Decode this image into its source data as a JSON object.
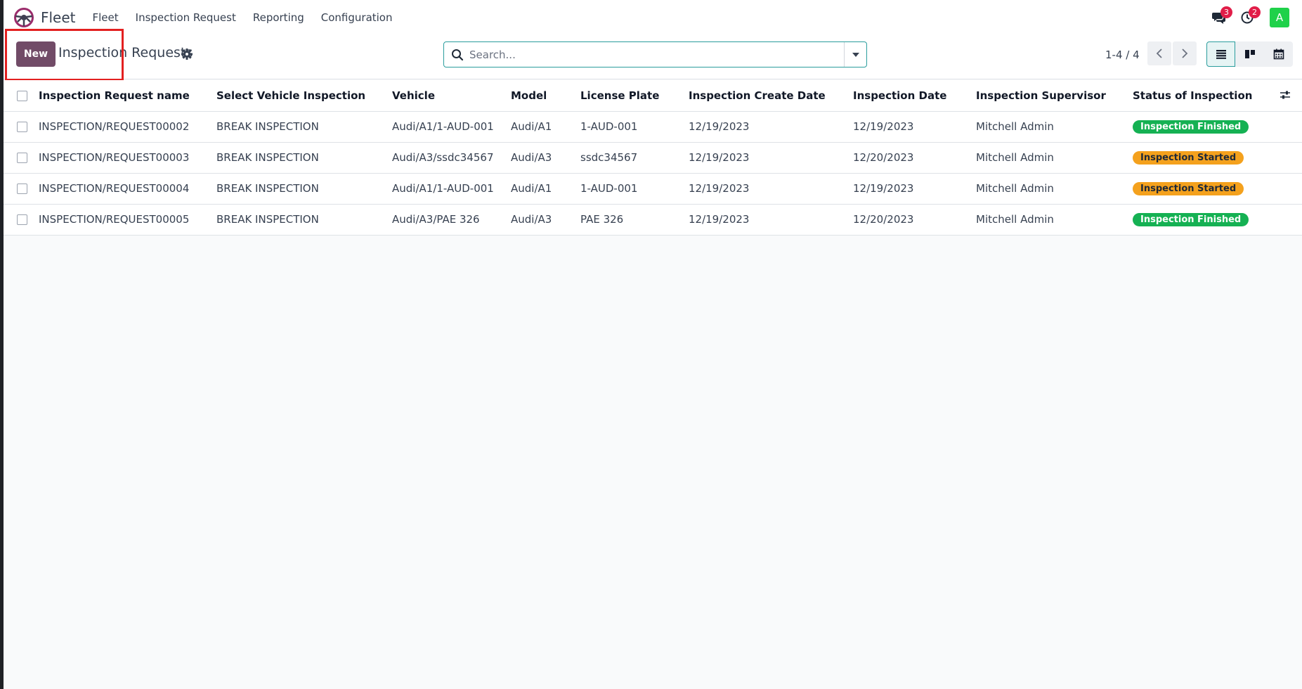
{
  "navbar": {
    "app_name": "Fleet",
    "menu": [
      {
        "label": "Fleet"
      },
      {
        "label": "Inspection Request"
      },
      {
        "label": "Reporting"
      },
      {
        "label": "Configuration"
      }
    ],
    "messages_count": "3",
    "activities_count": "2",
    "avatar_initial": "A",
    "avatar_color": "#1fd14a"
  },
  "control_panel": {
    "new_button_label": "New",
    "title": "Inspection Requests",
    "search_placeholder": "Search...",
    "pager_value": "1-4 / 4",
    "accent_color": "#714b67",
    "highlight_color": "#e32020"
  },
  "table": {
    "columns": [
      "Inspection Request name",
      "Select Vehicle Inspection",
      "Vehicle",
      "Model",
      "License Plate",
      "Inspection Create Date",
      "Inspection Date",
      "Inspection Supervisor",
      "Status of Inspection"
    ],
    "rows": [
      {
        "name": "INSPECTION/REQUEST00002",
        "inspection": "BREAK INSPECTION",
        "vehicle": "Audi/A1/1-AUD-001",
        "model": "Audi/A1",
        "plate": "1-AUD-001",
        "create_date": "12/19/2023",
        "inspection_date": "12/19/2023",
        "supervisor": "Mitchell Admin",
        "status": "Inspection Finished",
        "status_kind": "finished"
      },
      {
        "name": "INSPECTION/REQUEST00003",
        "inspection": "BREAK INSPECTION",
        "vehicle": "Audi/A3/ssdc34567",
        "model": "Audi/A3",
        "plate": "ssdc34567",
        "create_date": "12/19/2023",
        "inspection_date": "12/20/2023",
        "supervisor": "Mitchell Admin",
        "status": "Inspection Started",
        "status_kind": "started"
      },
      {
        "name": "INSPECTION/REQUEST00004",
        "inspection": "BREAK INSPECTION",
        "vehicle": "Audi/A1/1-AUD-001",
        "model": "Audi/A1",
        "plate": "1-AUD-001",
        "create_date": "12/19/2023",
        "inspection_date": "12/19/2023",
        "supervisor": "Mitchell Admin",
        "status": "Inspection Started",
        "status_kind": "started"
      },
      {
        "name": "INSPECTION/REQUEST00005",
        "inspection": "BREAK INSPECTION",
        "vehicle": "Audi/A3/PAE 326",
        "model": "Audi/A3",
        "plate": "PAE 326",
        "create_date": "12/19/2023",
        "inspection_date": "12/20/2023",
        "supervisor": "Mitchell Admin",
        "status": "Inspection Finished",
        "status_kind": "finished"
      }
    ]
  }
}
